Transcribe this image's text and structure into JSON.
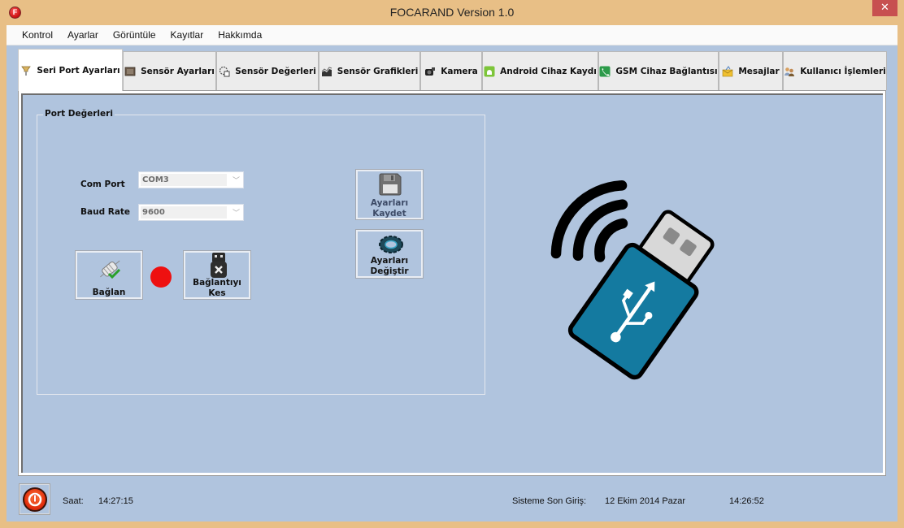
{
  "window": {
    "title": "FOCARAND Version 1.0",
    "app_icon_letter": "F",
    "close_glyph": "✕"
  },
  "menu": [
    "Kontrol",
    "Ayarlar",
    "Görüntüle",
    "Kayıtlar",
    "Hakkımda"
  ],
  "tabs": [
    {
      "label": "Seri Port Ayarları",
      "icon": "serial-port-icon",
      "active": true
    },
    {
      "label": "Sensör Ayarları",
      "icon": "sensor-chip-icon",
      "active": false
    },
    {
      "label": "Sensör Değerleri",
      "icon": "sensor-values-icon",
      "active": false
    },
    {
      "label": "Sensör Grafikleri",
      "icon": "chart-icon",
      "active": false
    },
    {
      "label": "Kamera",
      "icon": "camera-icon",
      "active": false
    },
    {
      "label": "Android Cihaz Kaydı",
      "icon": "android-icon",
      "active": false
    },
    {
      "label": "GSM Cihaz Bağlantısı",
      "icon": "phone-icon",
      "active": false
    },
    {
      "label": "Mesajlar",
      "icon": "message-icon",
      "active": false
    },
    {
      "label": "Kullanıcı İşlemleri",
      "icon": "users-icon",
      "active": false
    }
  ],
  "port_group": {
    "title": "Port Değerleri",
    "com_port": {
      "label": "Com Port",
      "value": "COM3"
    },
    "baud_rate": {
      "label": "Baud Rate",
      "value": "9600"
    },
    "connect_button": "Bağlan",
    "disconnect_button_line1": "Bağlantıyı",
    "disconnect_button_line2": "Kes",
    "connection_status_color": "#ee1010"
  },
  "settings_buttons": {
    "save_line1": "Ayarları",
    "save_line2": "Kaydet",
    "change_line1": "Ayarları",
    "change_line2": "Değiştir"
  },
  "statusbar": {
    "time_label": "Saat:",
    "time_value": "14:27:15",
    "last_login_label": "Sisteme Son Giriş:",
    "last_login_date": "12 Ekim 2014 Pazar",
    "last_login_time": "14:26:52"
  },
  "colors": {
    "frame": "#e8bf86",
    "panel": "#b0c4de",
    "close_button": "#c75050"
  }
}
